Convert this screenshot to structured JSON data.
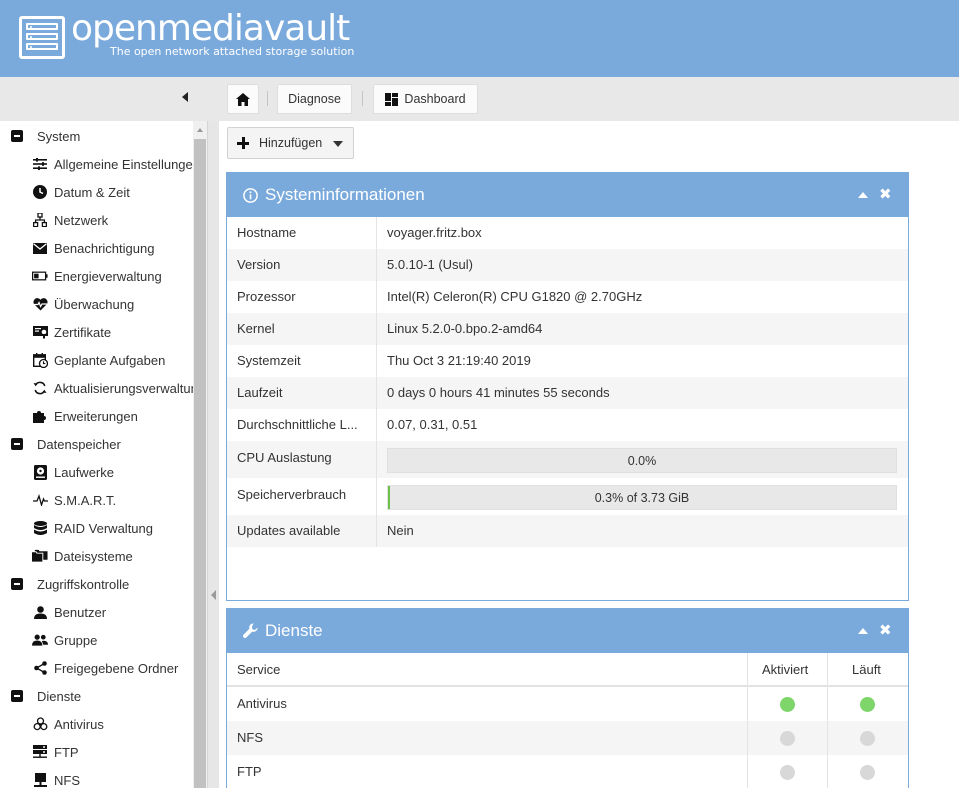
{
  "brand": {
    "name": "openmediavault",
    "tagline": "The open network attached storage solution",
    "header_color": "#7aa9dc"
  },
  "breadcrumb": {
    "home_icon": "home-icon",
    "items": [
      {
        "label": "Diagnose"
      },
      {
        "label": "Dashboard",
        "icon": "dashboard-icon"
      }
    ]
  },
  "sidebar": {
    "items": [
      {
        "label": "System",
        "type": "group",
        "icon": "minus-square-icon"
      },
      {
        "label": "Allgemeine Einstellungen",
        "type": "child",
        "icon": "sliders-icon"
      },
      {
        "label": "Datum & Zeit",
        "type": "child",
        "icon": "clock-icon"
      },
      {
        "label": "Netzwerk",
        "type": "child",
        "icon": "network-icon"
      },
      {
        "label": "Benachrichtigung",
        "type": "child",
        "icon": "envelope-icon"
      },
      {
        "label": "Energieverwaltung",
        "type": "child",
        "icon": "battery-icon"
      },
      {
        "label": "Überwachung",
        "type": "child",
        "icon": "heartbeat-icon"
      },
      {
        "label": "Zertifikate",
        "type": "child",
        "icon": "certificate-icon"
      },
      {
        "label": "Geplante Aufgaben",
        "type": "child",
        "icon": "calendar-clock-icon"
      },
      {
        "label": "Aktualisierungsverwaltung",
        "type": "child",
        "icon": "refresh-icon"
      },
      {
        "label": "Erweiterungen",
        "type": "child",
        "icon": "puzzle-icon"
      },
      {
        "label": "Datenspeicher",
        "type": "group",
        "icon": "minus-square-icon"
      },
      {
        "label": "Laufwerke",
        "type": "child",
        "icon": "harddisk-icon"
      },
      {
        "label": "S.M.A.R.T.",
        "type": "child",
        "icon": "pulse-icon"
      },
      {
        "label": "RAID Verwaltung",
        "type": "child",
        "icon": "database-icon"
      },
      {
        "label": "Dateisysteme",
        "type": "child",
        "icon": "folders-icon"
      },
      {
        "label": "Zugriffskontrolle",
        "type": "group",
        "icon": "minus-square-icon"
      },
      {
        "label": "Benutzer",
        "type": "child",
        "icon": "user-icon"
      },
      {
        "label": "Gruppe",
        "type": "child",
        "icon": "users-icon"
      },
      {
        "label": "Freigegebene Ordner",
        "type": "child",
        "icon": "share-icon"
      },
      {
        "label": "Dienste",
        "type": "group",
        "icon": "minus-square-icon"
      },
      {
        "label": "Antivirus",
        "type": "child",
        "icon": "biohazard-icon"
      },
      {
        "label": "FTP",
        "type": "child",
        "icon": "server-icon"
      },
      {
        "label": "NFS",
        "type": "child",
        "icon": "desktop-icon"
      }
    ]
  },
  "toolbar": {
    "add_label": "Hinzufügen"
  },
  "sysinfo": {
    "title": "Systeminformationen",
    "rows": [
      {
        "key": "Hostname",
        "value": "voyager.fritz.box"
      },
      {
        "key": "Version",
        "value": "5.0.10-1 (Usul)"
      },
      {
        "key": "Prozessor",
        "value": "Intel(R) Celeron(R) CPU G1820 @ 2.70GHz"
      },
      {
        "key": "Kernel",
        "value": "Linux 5.2.0-0.bpo.2-amd64"
      },
      {
        "key": "Systemzeit",
        "value": "Thu Oct 3 21:19:40 2019"
      },
      {
        "key": "Laufzeit",
        "value": "0 days 0 hours 41 minutes 55 seconds"
      },
      {
        "key": "Durchschnittliche L...",
        "value": "0.07, 0.31, 0.51"
      }
    ],
    "cpu": {
      "key": "CPU Auslastung",
      "text": "0.0%",
      "fraction": 0.0
    },
    "memory": {
      "key": "Speicherverbrauch",
      "text": "0.3% of 3.73 GiB",
      "fraction": 0.003
    },
    "updates": {
      "key": "Updates available",
      "value": "Nein"
    }
  },
  "services": {
    "title": "Dienste",
    "columns": [
      "Service",
      "Aktiviert",
      "Läuft"
    ],
    "rows": [
      {
        "name": "Antivirus",
        "enabled": true,
        "running": true
      },
      {
        "name": "NFS",
        "enabled": false,
        "running": false
      },
      {
        "name": "FTP",
        "enabled": false,
        "running": false
      }
    ],
    "on_color": "#7ed56a",
    "off_color": "#d8d8d8"
  }
}
